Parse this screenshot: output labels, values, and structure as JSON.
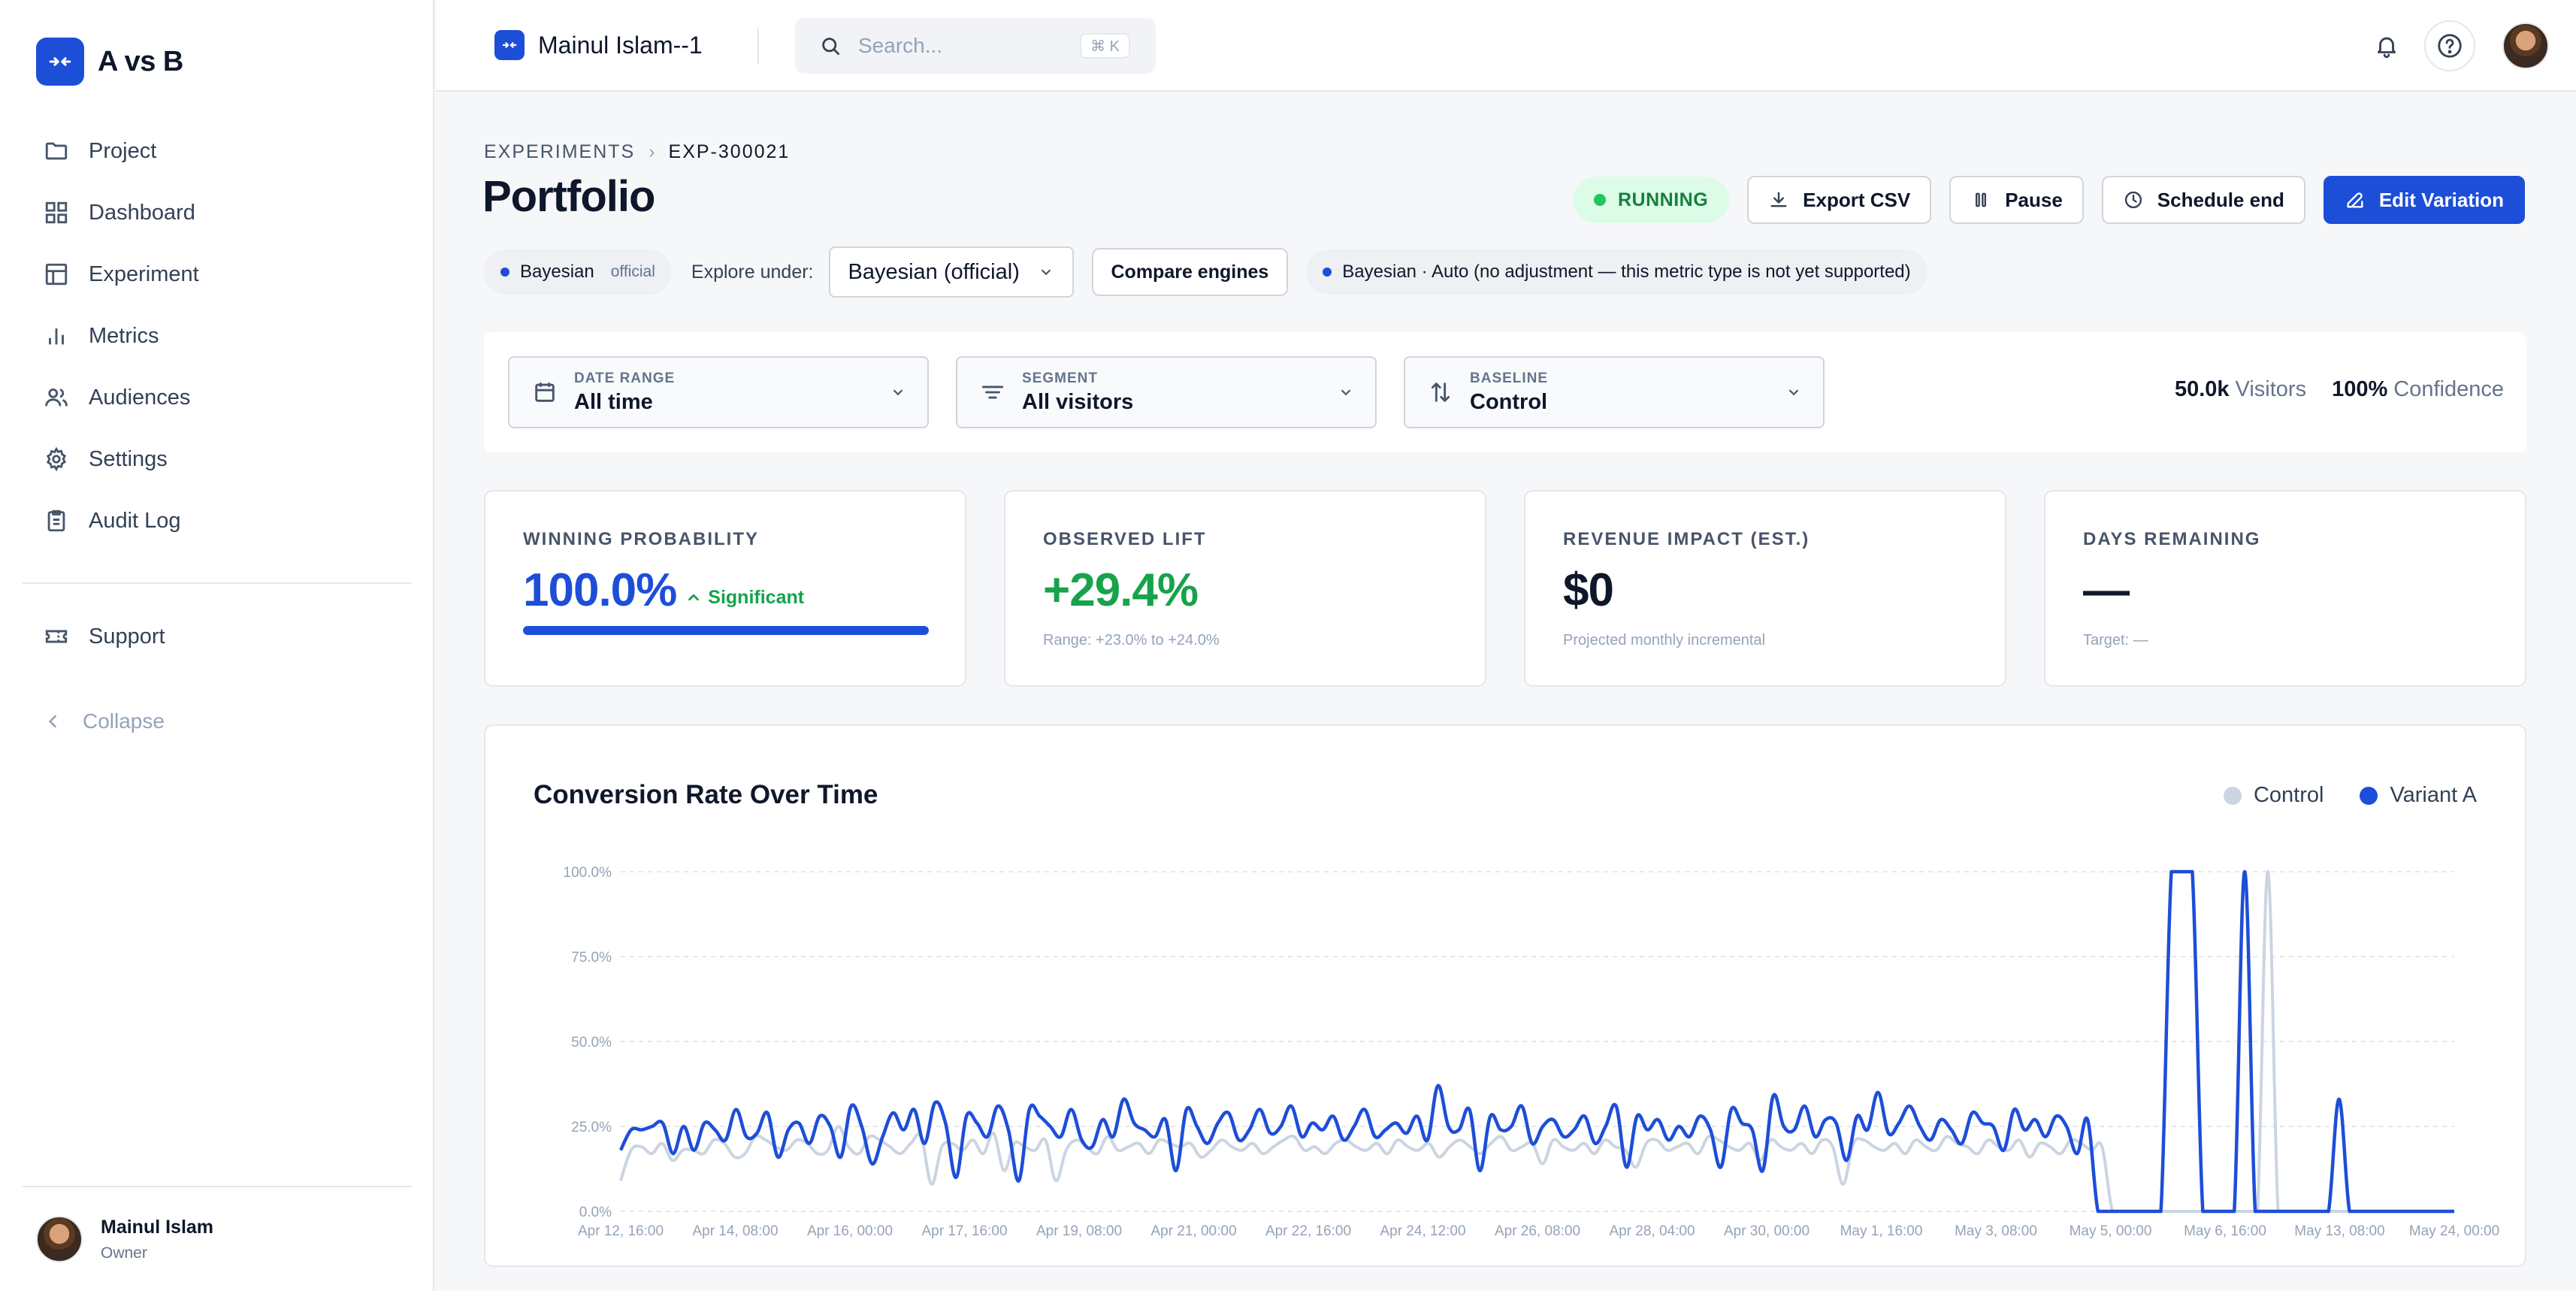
{
  "app": {
    "name": "A vs B"
  },
  "sidebar": {
    "items": [
      {
        "label": "Project",
        "icon": "folder-icon"
      },
      {
        "label": "Dashboard",
        "icon": "dashboard-grid-icon"
      },
      {
        "label": "Experiment",
        "icon": "table-icon"
      },
      {
        "label": "Metrics",
        "icon": "bar-chart-icon"
      },
      {
        "label": "Audiences",
        "icon": "users-icon"
      },
      {
        "label": "Settings",
        "icon": "gear-icon"
      },
      {
        "label": "Audit Log",
        "icon": "clipboard-icon"
      }
    ],
    "support": {
      "label": "Support",
      "icon": "ticket-icon"
    },
    "collapse": "Collapse",
    "user": {
      "name": "Mainul Islam",
      "role": "Owner"
    }
  },
  "topbar": {
    "workspace": "Mainul Islam--1",
    "search_placeholder": "Search...",
    "search_shortcut": "⌘ K"
  },
  "breadcrumb": {
    "root": "EXPERIMENTS",
    "current": "EXP-300021"
  },
  "page": {
    "title": "Portfolio"
  },
  "actions": {
    "status": "RUNNING",
    "export": "Export CSV",
    "pause": "Pause",
    "schedule": "Schedule end",
    "edit": "Edit Variation"
  },
  "engine": {
    "engine_chip": "Bayesian",
    "engine_tag": "official",
    "explore_label": "Explore under:",
    "explore_value": "Bayesian (official)",
    "compare": "Compare engines",
    "adjustment": "Bayesian · Auto (no adjustment — this metric type is not yet supported)"
  },
  "filters": {
    "date_range": {
      "label": "DATE RANGE",
      "value": "All time"
    },
    "segment": {
      "label": "SEGMENT",
      "value": "All visitors"
    },
    "baseline": {
      "label": "BASELINE",
      "value": "Control"
    },
    "visitors_value": "50.0k",
    "visitors_label": "Visitors",
    "confidence_value": "100%",
    "confidence_label": "Confidence"
  },
  "kpis": {
    "winning": {
      "label": "WINNING PROBABILITY",
      "value": "100.0%",
      "badge": "Significant",
      "progress": 1.0
    },
    "lift": {
      "label": "OBSERVED LIFT",
      "value": "+29.4%",
      "sub": "Range: +23.0% to +24.0%"
    },
    "revenue": {
      "label": "REVENUE IMPACT (EST.)",
      "value": "$0",
      "sub": "Projected monthly incremental"
    },
    "days": {
      "label": "DAYS REMAINING",
      "value": "—",
      "sub": "Target: —"
    }
  },
  "colors": {
    "accent": "#1d4ed8",
    "success": "#16a34a",
    "control": "#cbd5e1",
    "variant": "#1d4ed8"
  },
  "chart_data": {
    "type": "line",
    "title": "Conversion Rate Over Time",
    "xlabel": "",
    "ylabel": "",
    "ylim": [
      0,
      100
    ],
    "yticks": [
      "0.0%",
      "25.0%",
      "50.0%",
      "75.0%",
      "100.0%"
    ],
    "x_ticks": [
      "Apr 12, 16:00",
      "Apr 14, 08:00",
      "Apr 16, 00:00",
      "Apr 17, 16:00",
      "Apr 19, 08:00",
      "Apr 21, 00:00",
      "Apr 22, 16:00",
      "Apr 24, 12:00",
      "Apr 26, 08:00",
      "Apr 28, 04:00",
      "Apr 30, 00:00",
      "May 1, 16:00",
      "May 3, 08:00",
      "May 5, 00:00",
      "May 6, 16:00",
      "May 13, 08:00",
      "May 24, 00:00"
    ],
    "grid": true,
    "legend_position": "top-right",
    "series": [
      {
        "name": "Control",
        "color": "#cbd5e1",
        "values": [
          9,
          18,
          19,
          17,
          20,
          15,
          18,
          18,
          17,
          21,
          20,
          16,
          17,
          22,
          21,
          19,
          18,
          21,
          20,
          17,
          18,
          25,
          19,
          17,
          22,
          21,
          19,
          17,
          20,
          22,
          8,
          19,
          20,
          18,
          21,
          17,
          23,
          12,
          20,
          19,
          18,
          21,
          9,
          18,
          21,
          19,
          17,
          22,
          18,
          19,
          20,
          17,
          21,
          20,
          19,
          20,
          16,
          18,
          21,
          19,
          18,
          20,
          17,
          19,
          21,
          22,
          18,
          19,
          17,
          20,
          21,
          19,
          18,
          20,
          17,
          21,
          19,
          18,
          20,
          16,
          19,
          21,
          19,
          17,
          20,
          22,
          18,
          19,
          20,
          14,
          21,
          19,
          18,
          20,
          17,
          21,
          19,
          18,
          13,
          20,
          21,
          18,
          19,
          20,
          17,
          22,
          21,
          19,
          18,
          20,
          15,
          21,
          19,
          18,
          20,
          17,
          21,
          19,
          8,
          20,
          21,
          19,
          18,
          20,
          17,
          21,
          19,
          18,
          22,
          20,
          19,
          17,
          21,
          19,
          18,
          21,
          16,
          20,
          19,
          17,
          21,
          20,
          18,
          19,
          0,
          0,
          0,
          0,
          0,
          0,
          0,
          0,
          0,
          0,
          0,
          0,
          0,
          0,
          0,
          100,
          0,
          0,
          0,
          0,
          0,
          0,
          0,
          0,
          0,
          0,
          0,
          0,
          0,
          0,
          0,
          0,
          0,
          0
        ]
      },
      {
        "name": "Variant A",
        "color": "#1d4ed8",
        "values": [
          18,
          24,
          24,
          25,
          26,
          17,
          25,
          18,
          26,
          24,
          21,
          30,
          22,
          23,
          29,
          16,
          24,
          26,
          20,
          28,
          25,
          16,
          31,
          25,
          14,
          22,
          29,
          24,
          30,
          20,
          32,
          26,
          10,
          28,
          26,
          22,
          31,
          24,
          9,
          30,
          28,
          25,
          22,
          30,
          21,
          19,
          27,
          22,
          33,
          26,
          24,
          22,
          27,
          12,
          30,
          25,
          20,
          26,
          29,
          21,
          24,
          30,
          23,
          25,
          31,
          22,
          26,
          24,
          28,
          21,
          25,
          30,
          22,
          24,
          26,
          23,
          28,
          21,
          37,
          25,
          24,
          30,
          12,
          28,
          24,
          25,
          31,
          20,
          25,
          27,
          22,
          24,
          28,
          20,
          25,
          31,
          13,
          28,
          24,
          27,
          21,
          25,
          22,
          28,
          24,
          13,
          30,
          26,
          24,
          12,
          34,
          25,
          24,
          31,
          22,
          27,
          26,
          15,
          28,
          24,
          35,
          23,
          26,
          31,
          25,
          21,
          27,
          24,
          20,
          29,
          26,
          25,
          18,
          30,
          24,
          27,
          22,
          28,
          25,
          17,
          27,
          0,
          0,
          0,
          0,
          0,
          0,
          0,
          100,
          100,
          100,
          0,
          0,
          0,
          0,
          100,
          0,
          0,
          0,
          0,
          0,
          0,
          0,
          0,
          33,
          0,
          0,
          0,
          0,
          0,
          0,
          0,
          0,
          0,
          0,
          0
        ]
      }
    ]
  }
}
